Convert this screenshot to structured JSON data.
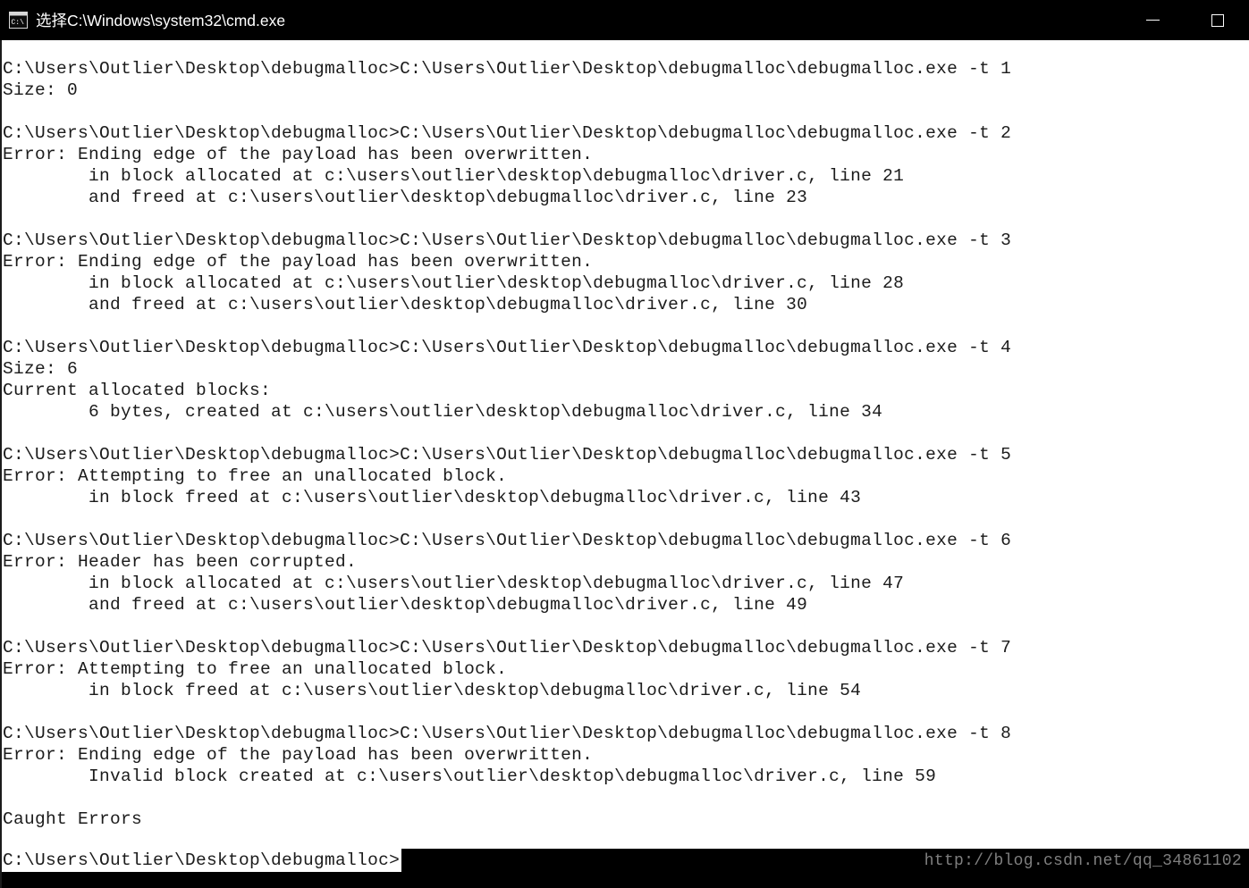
{
  "window": {
    "title": "选择C:\\Windows\\system32\\cmd.exe",
    "icon": "cmd-console-icon",
    "titlebar_bg": "#000000",
    "controls": {
      "minimize_label": "",
      "maximize_label": ""
    }
  },
  "console": {
    "background": "#ffffff",
    "foreground": "#1b1b1b",
    "lines": [
      "C:\\Users\\Outlier\\Desktop\\debugmalloc>C:\\Users\\Outlier\\Desktop\\debugmalloc\\debugmalloc.exe -t 1",
      "Size: 0",
      "",
      "C:\\Users\\Outlier\\Desktop\\debugmalloc>C:\\Users\\Outlier\\Desktop\\debugmalloc\\debugmalloc.exe -t 2",
      "Error: Ending edge of the payload has been overwritten.",
      "        in block allocated at c:\\users\\outlier\\desktop\\debugmalloc\\driver.c, line 21",
      "        and freed at c:\\users\\outlier\\desktop\\debugmalloc\\driver.c, line 23",
      "",
      "C:\\Users\\Outlier\\Desktop\\debugmalloc>C:\\Users\\Outlier\\Desktop\\debugmalloc\\debugmalloc.exe -t 3",
      "Error: Ending edge of the payload has been overwritten.",
      "        in block allocated at c:\\users\\outlier\\desktop\\debugmalloc\\driver.c, line 28",
      "        and freed at c:\\users\\outlier\\desktop\\debugmalloc\\driver.c, line 30",
      "",
      "C:\\Users\\Outlier\\Desktop\\debugmalloc>C:\\Users\\Outlier\\Desktop\\debugmalloc\\debugmalloc.exe -t 4",
      "Size: 6",
      "Current allocated blocks:",
      "        6 bytes, created at c:\\users\\outlier\\desktop\\debugmalloc\\driver.c, line 34",
      "",
      "C:\\Users\\Outlier\\Desktop\\debugmalloc>C:\\Users\\Outlier\\Desktop\\debugmalloc\\debugmalloc.exe -t 5",
      "Error: Attempting to free an unallocated block.",
      "        in block freed at c:\\users\\outlier\\desktop\\debugmalloc\\driver.c, line 43",
      "",
      "C:\\Users\\Outlier\\Desktop\\debugmalloc>C:\\Users\\Outlier\\Desktop\\debugmalloc\\debugmalloc.exe -t 6",
      "Error: Header has been corrupted.",
      "        in block allocated at c:\\users\\outlier\\desktop\\debugmalloc\\driver.c, line 47",
      "        and freed at c:\\users\\outlier\\desktop\\debugmalloc\\driver.c, line 49",
      "",
      "C:\\Users\\Outlier\\Desktop\\debugmalloc>C:\\Users\\Outlier\\Desktop\\debugmalloc\\debugmalloc.exe -t 7",
      "Error: Attempting to free an unallocated block.",
      "        in block freed at c:\\users\\outlier\\desktop\\debugmalloc\\driver.c, line 54",
      "",
      "C:\\Users\\Outlier\\Desktop\\debugmalloc>C:\\Users\\Outlier\\Desktop\\debugmalloc\\debugmalloc.exe -t 8",
      "Error: Ending edge of the payload has been overwritten.",
      "        Invalid block created at c:\\users\\outlier\\desktop\\debugmalloc\\driver.c, line 59",
      "",
      "Caught Errors",
      ""
    ],
    "prompt": "C:\\Users\\Outlier\\Desktop\\debugmalloc>"
  },
  "watermark": {
    "text": "http://blog.csdn.net/qq_34861102",
    "color": "#7f7f7f"
  }
}
